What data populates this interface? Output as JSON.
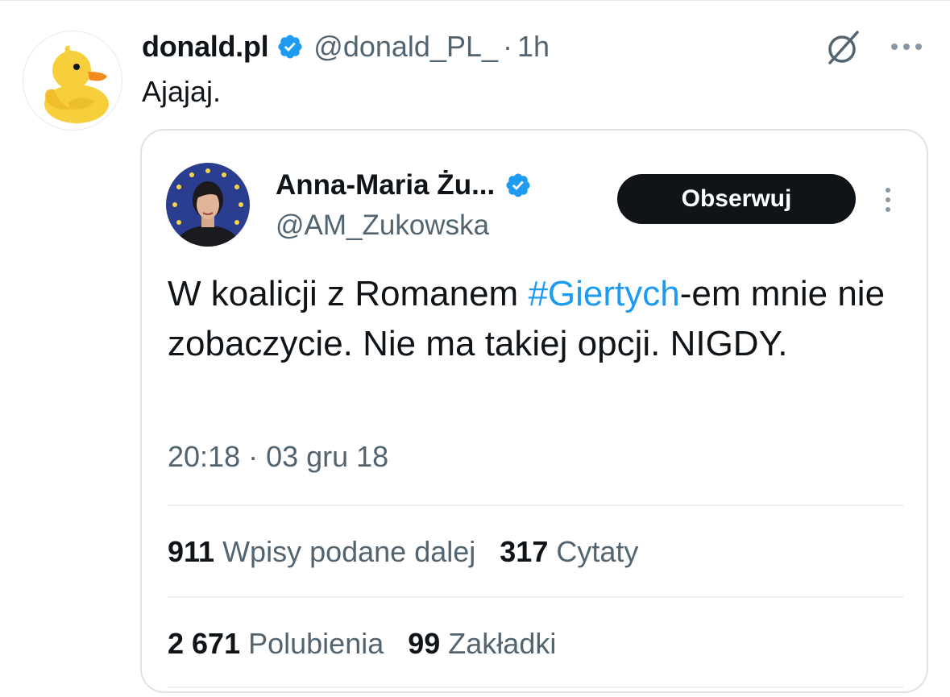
{
  "post": {
    "display_name": "donald.pl",
    "handle": "@donald_PL_",
    "separator": "·",
    "time": "1h",
    "text": "Ajajaj.",
    "avatar_icon": "duck-icon"
  },
  "quote": {
    "display_name": "Anna-Maria Żu...",
    "handle": "@AM_Zukowska",
    "follow_label": "Obserwuj",
    "text_before": "W koalicji z Romanem ",
    "hashtag": "#Giertych",
    "text_after": "-em mnie nie zobaczycie. Nie ma takiej opcji. NIGDY.",
    "timestamp": "20:18 · 03 gru 18",
    "stats_row1": [
      {
        "count": "911",
        "label": "Wpisy podane dalej"
      },
      {
        "count": "317",
        "label": "Cytaty"
      }
    ],
    "stats_row2": [
      {
        "count": "2 671",
        "label": "Polubienia"
      },
      {
        "count": "99",
        "label": "Zakładki"
      }
    ]
  },
  "colors": {
    "accent": "#1d9bf0",
    "text": "#0f1419",
    "muted": "#536471",
    "border": "#dfe3e6"
  }
}
